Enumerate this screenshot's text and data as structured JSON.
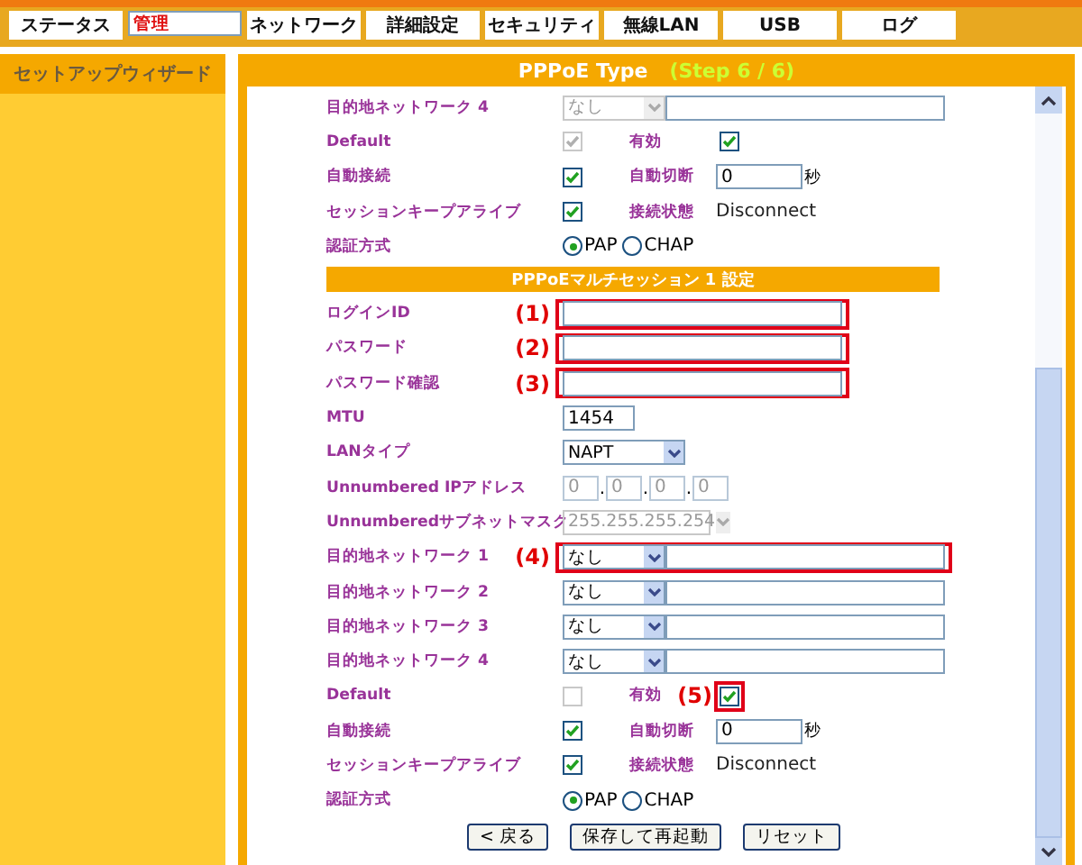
{
  "tabs": [
    {
      "label": "ステータス",
      "selected": false
    },
    {
      "label": "管理",
      "selected": true
    },
    {
      "label": "ネットワーク",
      "selected": false
    },
    {
      "label": "詳細設定",
      "selected": false
    },
    {
      "label": "セキュリティ",
      "selected": false
    },
    {
      "label": "無線LAN",
      "selected": false
    },
    {
      "label": "USB",
      "selected": false
    },
    {
      "label": "ログ",
      "selected": false
    }
  ],
  "sidebar": {
    "title": "セットアップウィザード"
  },
  "panel": {
    "title": "PPPoE Type",
    "step": "(Step 6 / 6)"
  },
  "rows": [
    {
      "kind": "destination",
      "label": "目的地ネットワーク 4",
      "select": "なし",
      "disabled": true
    },
    {
      "kind": "default",
      "label": "Default",
      "checked": true,
      "disabled": true,
      "label2": "有効",
      "checked2": true
    },
    {
      "kind": "autoconnect",
      "label": "自動接続",
      "checked": true,
      "label2": "自動切断",
      "value": "0",
      "unit": "秒"
    },
    {
      "kind": "keepalive",
      "label": "セッションキープアライブ",
      "checked": true,
      "label2": "接続状態",
      "status": "Disconnect"
    },
    {
      "kind": "auth",
      "label": "認証方式",
      "options": [
        {
          "label": "PAP",
          "selected": true
        },
        {
          "label": "CHAP",
          "selected": false
        }
      ]
    },
    {
      "kind": "section",
      "title": "PPPoEマルチセッション 1 設定"
    },
    {
      "kind": "text",
      "label": "ログインID",
      "note": "(1)"
    },
    {
      "kind": "text",
      "label": "パスワード",
      "note": "(2)"
    },
    {
      "kind": "text",
      "label": "パスワード確認",
      "note": "(3)"
    },
    {
      "kind": "short",
      "label": "MTU",
      "value": "1454"
    },
    {
      "kind": "select",
      "label": "LANタイプ",
      "select": "NAPT"
    },
    {
      "kind": "ip",
      "label": "Unnumbered IPアドレス",
      "octets": [
        "0",
        "0",
        "0",
        "0"
      ],
      "separator": ".",
      "disabled": true
    },
    {
      "kind": "mask",
      "label": "Unnumberedサブネットマスク",
      "select": "255.255.255.254",
      "disabled": true
    },
    {
      "kind": "destination",
      "label": "目的地ネットワーク 1",
      "select": "なし",
      "disabled": false,
      "note": "(4)"
    },
    {
      "kind": "destination",
      "label": "目的地ネットワーク 2",
      "select": "なし",
      "disabled": false
    },
    {
      "kind": "destination",
      "label": "目的地ネットワーク 3",
      "select": "なし",
      "disabled": false
    },
    {
      "kind": "destination",
      "label": "目的地ネットワーク 4",
      "select": "なし",
      "disabled": false
    },
    {
      "kind": "default",
      "label": "Default",
      "checked": false,
      "disabled": true,
      "label2": "有効",
      "checked2": true,
      "note2": "(5)"
    },
    {
      "kind": "autoconnect",
      "label": "自動接続",
      "checked": true,
      "label2": "自動切断",
      "value": "0",
      "unit": "秒"
    },
    {
      "kind": "keepalive",
      "label": "セッションキープアライブ",
      "checked": true,
      "label2": "接続状態",
      "status": "Disconnect"
    },
    {
      "kind": "auth",
      "label": "認証方式",
      "options": [
        {
          "label": "PAP",
          "selected": true
        },
        {
          "label": "CHAP",
          "selected": false
        }
      ]
    }
  ],
  "buttons": [
    "< 戻る",
    "保存して再起動",
    "リセット"
  ]
}
